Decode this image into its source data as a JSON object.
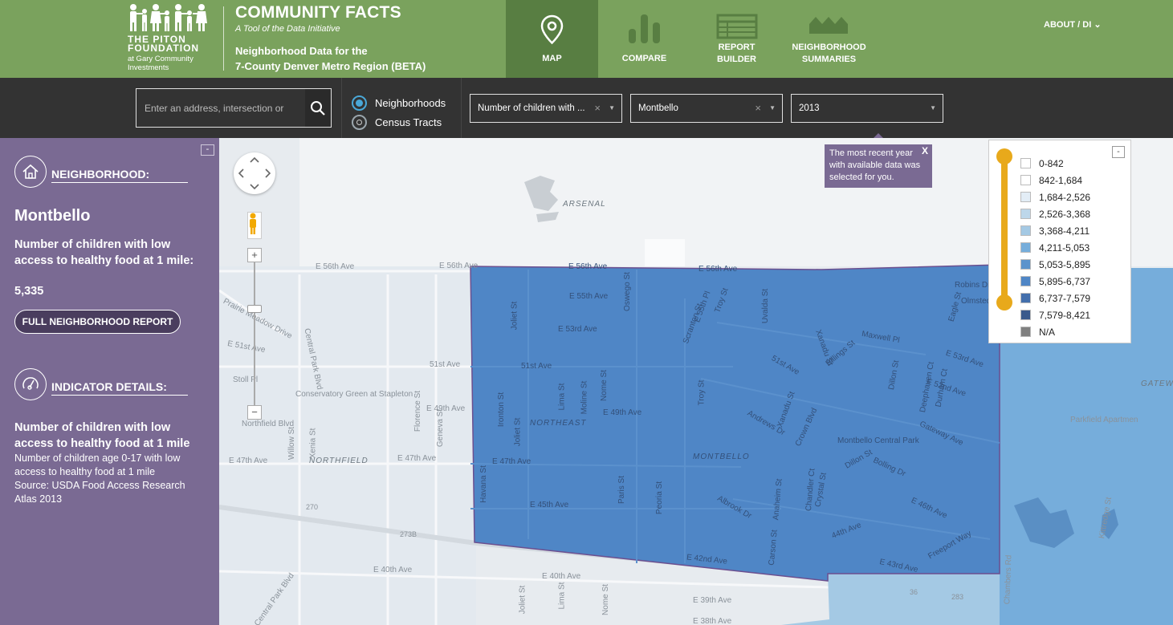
{
  "header": {
    "logo_name": "THE PITON FOUNDATION",
    "logo_sub": "at Gary Community Investments",
    "title": "COMMUNITY FACTS",
    "tagline": "A Tool of the Data Initiative",
    "description_line1": "Neighborhood Data for the",
    "description_line2": "7-County Denver Metro Region (BETA)",
    "nav": {
      "map": "MAP",
      "compare": "COMPARE",
      "report_builder_l1": "REPORT",
      "report_builder_l2": "BUILDER",
      "summaries_l1": "NEIGHBORHOOD",
      "summaries_l2": "SUMMARIES"
    },
    "about": "ABOUT / DI"
  },
  "toolbar": {
    "search_placeholder": "Enter an address, intersection or",
    "geography_options": [
      "Neighborhoods",
      "Census Tracts"
    ],
    "geography_selected": "Neighborhoods",
    "indicator_value": "Number of children with ...",
    "neighborhood_value": "Montbello",
    "year_value": "2013"
  },
  "tooltip": {
    "text": "The most recent year with available data was selected for you.",
    "close": "X"
  },
  "sidebar": {
    "collapse": "-",
    "neighborhood_heading": "NEIGHBORHOOD:",
    "neighborhood_name": "Montbello",
    "indicator_label": "Number of children with low access to healthy food at 1 mile:",
    "indicator_value": "5,335",
    "report_button": "FULL NEIGHBORHOOD REPORT",
    "details_heading": "INDICATOR DETAILS:",
    "details_title": "Number of children with low access to healthy food at 1 mile",
    "details_description": "Number of children age 0-17 with low access to healthy food at 1 mile",
    "details_source": "Source: USDA Food Access Research Atlas 2013"
  },
  "map": {
    "zoom_in": "+",
    "zoom_out": "−",
    "labels": {
      "arsenal": "ARSENAL",
      "northeast": "NORTHEAST",
      "montbello": "MONTBELLO",
      "northfield": "NORTHFIELD",
      "gateway": "GATEWA",
      "e56th": "E 56th Ave",
      "e56th_b": "E 56th Ave",
      "e56th_c": "E 56th Ave",
      "e56th_d": "E 56th Ave",
      "e55th": "E 55th Ave",
      "e53rd": "E 53rd Ave",
      "e53rd_b": "E 53rd Ave",
      "e52nd": "E 52nd Ave",
      "e51st": "51st Ave",
      "e51st_b": "51st Ave",
      "e51st_c": "51st Ave",
      "e51st_d": "E 51st Ave",
      "e49th": "E 49th Ave",
      "e49th_b": "E 49th Ave",
      "e47th": "E 47th Ave",
      "e47th_b": "E 47th Ave",
      "e47th_c": "E 47th Ave",
      "e46th": "E 46th Ave",
      "e45th": "E 45th Ave",
      "e44th": "44th Ave",
      "e43rd": "E 43rd Ave",
      "e42nd": "E 42nd Ave",
      "e40th": "E 40th Ave",
      "e40th_b": "E 40th Ave",
      "e39th": "E 39th Ave",
      "e38th": "E 38th Ave",
      "maxwell": "Maxwell Pl",
      "andrews": "Andrews Dr",
      "gateway_ave": "Gateway Ave",
      "bolling": "Bolling Dr",
      "dillon": "Dillon St",
      "dillon_b": "Dillon St",
      "albrook": "Albrook Dr",
      "crown": "Crown Blvd",
      "freeport": "Freeport Way",
      "central_park": "Montbello Central Park",
      "parkfield": "Parkfield Apartmen",
      "robins": "Robins Dr",
      "olmsted": "Olmsted Dr",
      "billings": "Billings St",
      "xanadu": "Xanadu St",
      "xanadu_b": "Xanadu St",
      "conservatory": "Conservatory Green at Stapleton",
      "northfield_blvd": "Northfield Blvd",
      "central_park_blvd": "Central Park Blvd",
      "central_park_blvd_b": "Central Park Blvd",
      "prairie": "Prairie Meadow Drive",
      "stoll": "Stoll Pl",
      "joliet": "Joliet St",
      "joliet_b": "Joliet St",
      "joliet_c": "Joliet St",
      "lima": "Lima St",
      "moline": "Moline St",
      "nome": "Nome St",
      "nome_b": "Nome St",
      "havana": "Havana St",
      "peoria": "Peoria St",
      "paris": "Paris St",
      "oswego": "Oswego St",
      "scranton": "Scranton St",
      "e55th_pl": "E 55th Pl",
      "troy": "Troy St",
      "troy_b": "Troy St",
      "uvalda": "Uvalda St",
      "deephaven": "Deephaven Ct",
      "durham": "Durham Ct",
      "eagle": "Eagle St",
      "chambers": "Chambers Rd",
      "kittredge": "Kittredge St",
      "carson": "Carson St",
      "chandler": "Chandler Ct",
      "crystal": "Crystal St",
      "anaheim": "Anaheim St",
      "florence": "Florence St",
      "geneva": "Geneva St",
      "ironton": "Ironton St",
      "willow": "Willow St",
      "xenia": "Xenia St",
      "lima_b": "Lima St",
      "rd_270": "270",
      "rd_270b": "270",
      "rd_36": "36",
      "rd_2738": "273B",
      "rd_283": "283"
    }
  },
  "legend": {
    "collapse": "-",
    "items": [
      {
        "label": "0-842",
        "color": "#ffffff"
      },
      {
        "label": "842-1,684",
        "color": "#ffffff"
      },
      {
        "label": "1,684-2,526",
        "color": "#e3edf6"
      },
      {
        "label": "2,526-3,368",
        "color": "#bdd7ea"
      },
      {
        "label": "3,368-4,211",
        "color": "#a4c9e4"
      },
      {
        "label": "4,211-5,053",
        "color": "#76addb"
      },
      {
        "label": "5,053-5,895",
        "color": "#5b93cc"
      },
      {
        "label": "5,895-6,737",
        "color": "#4f86c6"
      },
      {
        "label": "6,737-7,579",
        "color": "#436fac"
      },
      {
        "label": "7,579-8,421",
        "color": "#3a5a8c"
      },
      {
        "label": "N/A",
        "color": "#808080"
      }
    ]
  },
  "colors": {
    "header_green": "#7aa25d",
    "active_tab": "#587e42",
    "toolbar": "#333333",
    "sidebar_purple": "#7a6a93",
    "selected_area": "#4f86c6",
    "adjacent_area": "#76addb",
    "slider": "#e8a91b"
  }
}
